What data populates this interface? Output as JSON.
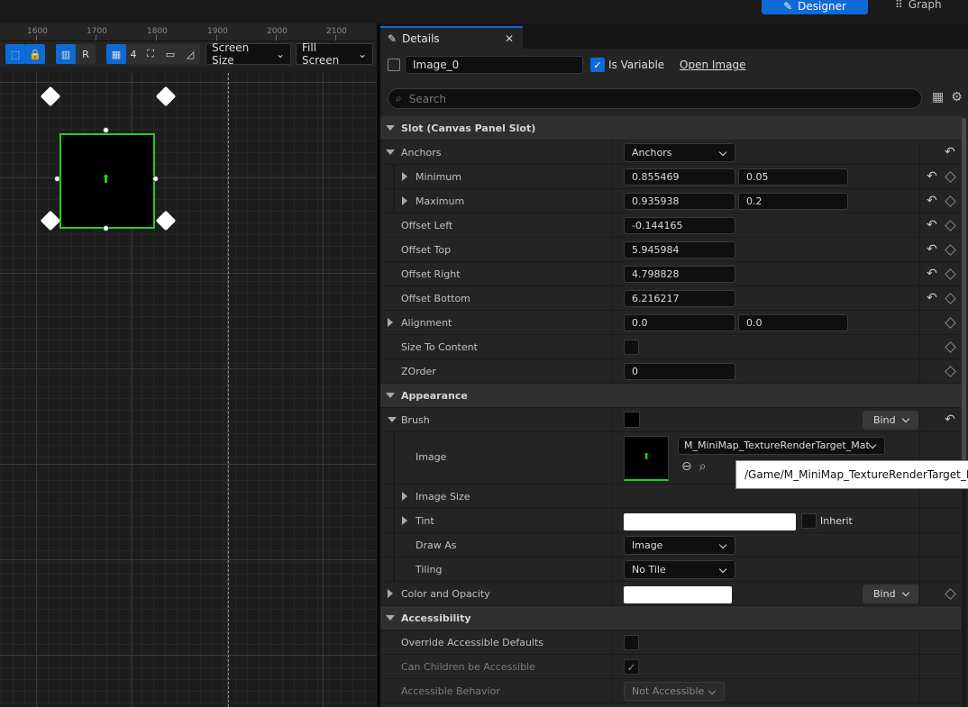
{
  "topbar": {
    "designer_label": "Designer",
    "graph_label": "Graph"
  },
  "ruler": {
    "ticks": [
      "1600",
      "1700",
      "1800",
      "1900",
      "2000",
      "2100"
    ]
  },
  "viewport_toolbar": {
    "grid_snap_value": "4",
    "r_label": "R",
    "screen_size": "Screen Size",
    "fill_screen": "Fill Screen"
  },
  "details": {
    "tab_label": "Details",
    "widget_name": "Image_0",
    "is_variable_label": "Is Variable",
    "open_image_label": "Open Image",
    "search_placeholder": "Search",
    "slot": {
      "title": "Slot (Canvas Panel Slot)",
      "anchors_label": "Anchors",
      "anchors_value": "Anchors",
      "minimum_label": "Minimum",
      "minimum_x": "0.855469",
      "minimum_y": "0.05",
      "maximum_label": "Maximum",
      "maximum_x": "0.935938",
      "maximum_y": "0.2",
      "offset_left_label": "Offset Left",
      "offset_left": "-0.144165",
      "offset_top_label": "Offset Top",
      "offset_top": "5.945984",
      "offset_right_label": "Offset Right",
      "offset_right": "4.798828",
      "offset_bottom_label": "Offset Bottom",
      "offset_bottom": "6.216217",
      "alignment_label": "Alignment",
      "alignment_x": "0.0",
      "alignment_y": "0.0",
      "size_to_content_label": "Size To Content",
      "zorder_label": "ZOrder",
      "zorder": "0"
    },
    "appearance": {
      "title": "Appearance",
      "brush_label": "Brush",
      "bind_label": "Bind",
      "image_label": "Image",
      "image_asset": "M_MiniMap_TextureRenderTarget_Mat",
      "image_tooltip": "/Game/M_MiniMap_TextureRenderTarget_Mat",
      "image_size_label": "Image Size",
      "tint_label": "Tint",
      "inherit_label": "Inherit",
      "draw_as_label": "Draw As",
      "draw_as_value": "Image",
      "tiling_label": "Tiling",
      "tiling_value": "No Tile",
      "color_opacity_label": "Color and Opacity",
      "color_bind_label": "Bind"
    },
    "accessibility": {
      "title": "Accessibility",
      "override_label": "Override Accessible Defaults",
      "children_label": "Can Children be Accessible",
      "behavior_label": "Accessible Behavior",
      "behavior_value": "Not Accessible"
    }
  },
  "colors": {
    "accent": "#0e6ad4",
    "selection": "#1fd11f"
  }
}
